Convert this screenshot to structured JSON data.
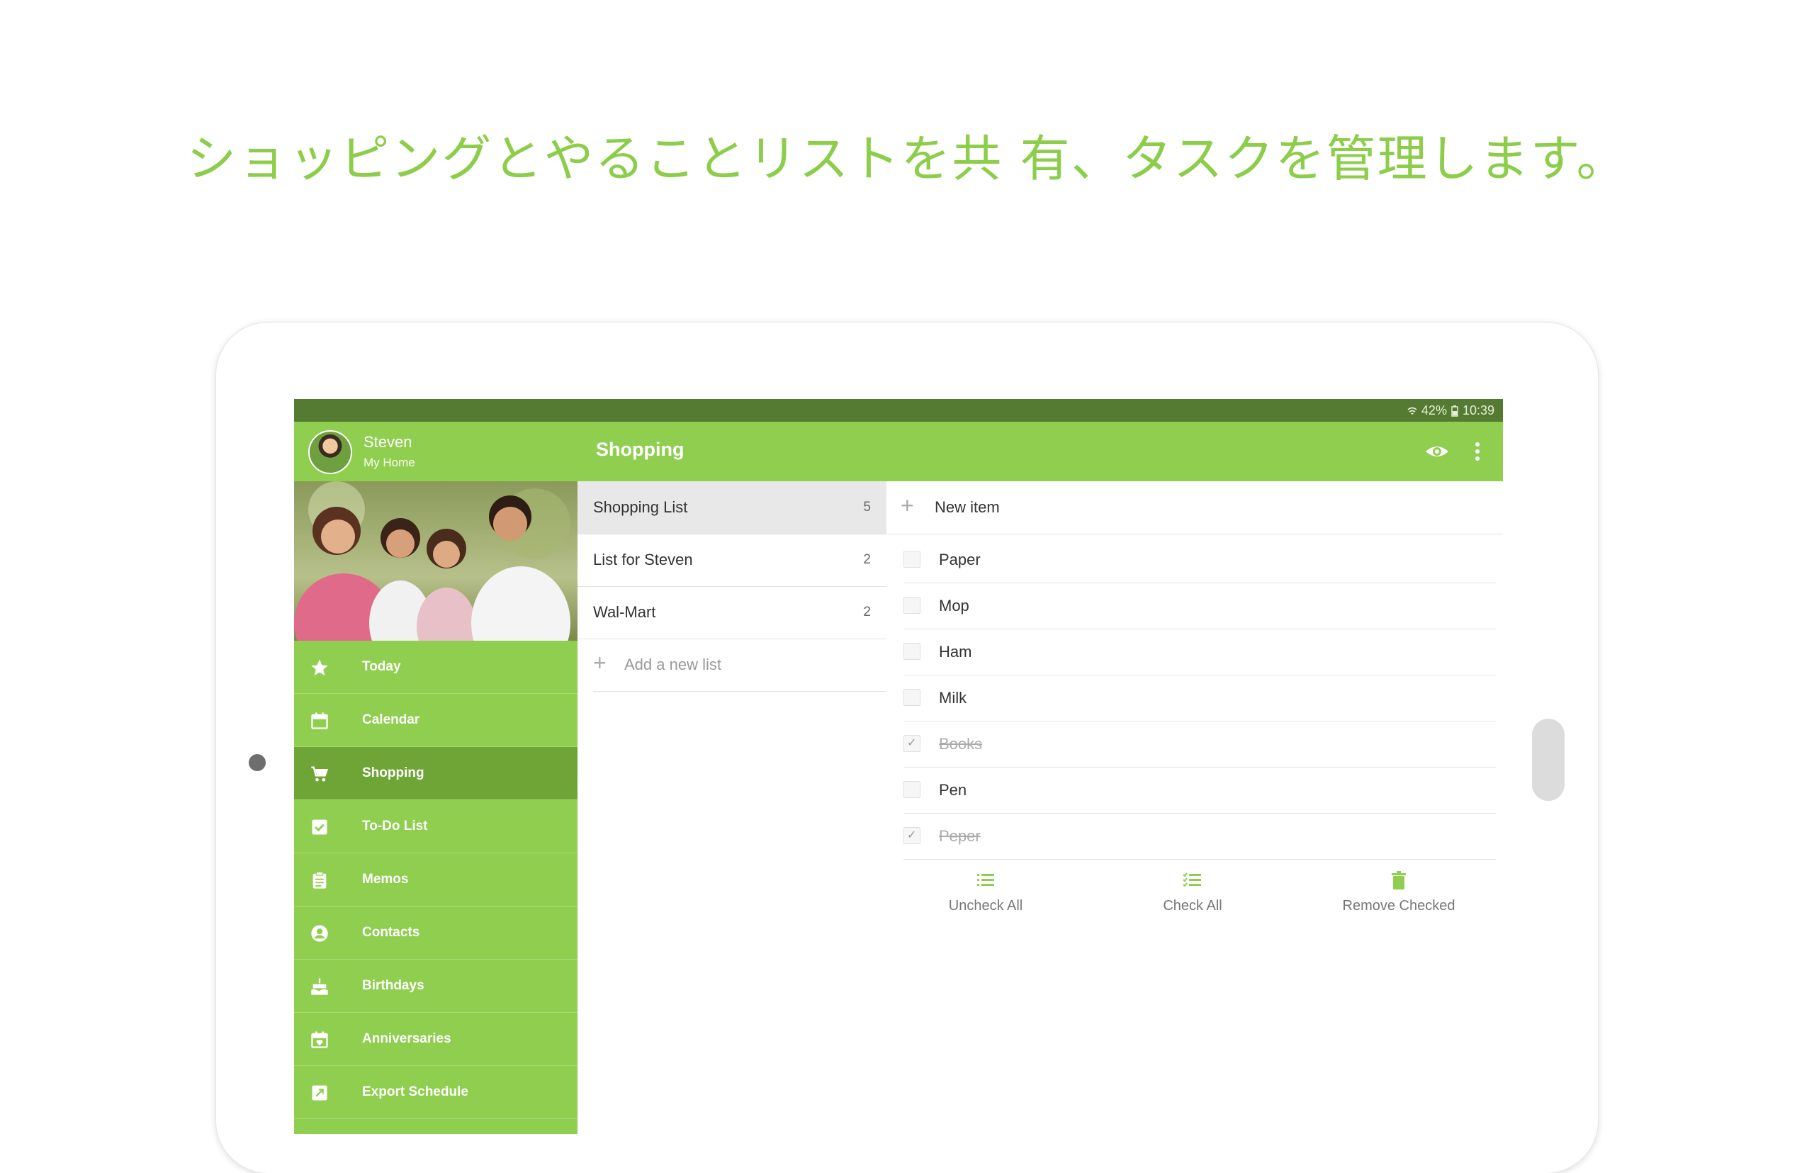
{
  "headline": "ショッピングとやることリストを共 有、タスクを管理します。",
  "colors": {
    "accent": "#8fce4f",
    "accent_dark": "#6fa436",
    "status_bar": "#557a32",
    "headline": "#8ccd4a"
  },
  "status_bar": {
    "battery": "42%",
    "time": "10:39"
  },
  "header": {
    "user_name": "Steven",
    "home_name": "My Home",
    "title": "Shopping"
  },
  "sidebar": {
    "items": [
      {
        "label": "Today",
        "icon": "star-icon"
      },
      {
        "label": "Calendar",
        "icon": "calendar-icon"
      },
      {
        "label": "Shopping",
        "icon": "cart-icon",
        "active": true
      },
      {
        "label": "To-Do List",
        "icon": "checkbox-icon"
      },
      {
        "label": "Memos",
        "icon": "clipboard-icon"
      },
      {
        "label": "Contacts",
        "icon": "contact-icon"
      },
      {
        "label": "Birthdays",
        "icon": "cake-icon"
      },
      {
        "label": "Anniversaries",
        "icon": "event-icon"
      },
      {
        "label": "Export Schedule",
        "icon": "export-icon"
      }
    ]
  },
  "lists": {
    "rows": [
      {
        "name": "Shopping List",
        "count": "5"
      },
      {
        "name": "List for Steven",
        "count": "2"
      },
      {
        "name": "Wal-Mart",
        "count": "2"
      }
    ],
    "add_label": "Add a new list"
  },
  "items": {
    "new_item_label": "New item",
    "rows": [
      {
        "label": "Paper",
        "checked": false
      },
      {
        "label": "Mop",
        "checked": false
      },
      {
        "label": "Ham",
        "checked": false
      },
      {
        "label": "Milk",
        "checked": false
      },
      {
        "label": "Books",
        "checked": true
      },
      {
        "label": "Pen",
        "checked": false
      },
      {
        "label": "Peper",
        "checked": true
      }
    ],
    "actions": {
      "uncheck_all": "Uncheck All",
      "check_all": "Check All",
      "remove_checked": "Remove Checked"
    }
  }
}
